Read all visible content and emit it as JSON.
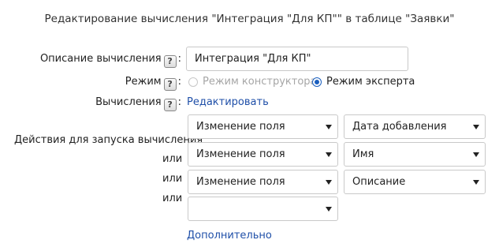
{
  "title": "Редактирование вычисления \"Интеграция \"Для КП\"\" в таблице \"Заявки\"",
  "fields": {
    "description_label": "Описание вычисления",
    "description_value": "Интеграция \"Для КП\"",
    "mode_label": "Режим",
    "mode_constructor": "Режим конструктора",
    "mode_expert": "Режим эксперта",
    "mode_selected": "expert",
    "calc_label": "Вычисления",
    "calc_link": "Редактировать",
    "help_glyph": "?",
    "colon": ":"
  },
  "triggers": {
    "label": "Действия для запуска вычисления",
    "or_label": "или",
    "rows": [
      {
        "action": "Изменение поля",
        "field": "Дата добавления"
      },
      {
        "action": "Изменение поля",
        "field": "Имя"
      },
      {
        "action": "Изменение поля",
        "field": "Описание"
      },
      {
        "action": "",
        "field": null
      }
    ]
  },
  "more_link": "Дополнительно",
  "icons": {
    "help": "help-icon",
    "dropdown": "chevron-down-icon"
  },
  "colors": {
    "link": "#1f4fa8",
    "radio_accent": "#1a5fbf",
    "disabled_text": "#a6a6a6"
  }
}
